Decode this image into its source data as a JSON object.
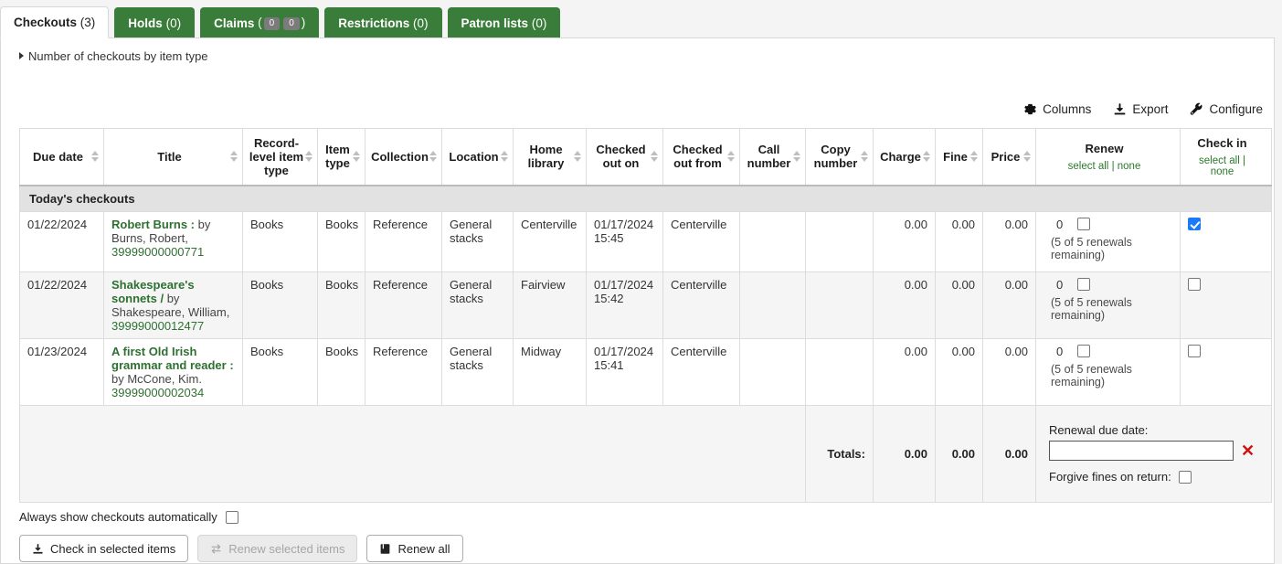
{
  "tabs": [
    {
      "label": "Checkouts",
      "count": "(3)",
      "active": true
    },
    {
      "label": "Holds",
      "count": "(0)",
      "active": false
    },
    {
      "label": "Claims",
      "count": "",
      "badges": [
        "0",
        "0"
      ],
      "active": false
    },
    {
      "label": "Restrictions",
      "count": "(0)",
      "active": false
    },
    {
      "label": "Patron lists",
      "count": "(0)",
      "active": false
    }
  ],
  "item_type_toggle": "Number of checkouts by item type",
  "toolbar": {
    "columns_label": "Columns",
    "export_label": "Export",
    "configure_label": "Configure"
  },
  "table": {
    "headers": [
      "Due date",
      "Title",
      "Record-level item type",
      "Item type",
      "Collection",
      "Location",
      "Home library",
      "Checked out on",
      "Checked out from",
      "Call number",
      "Copy number",
      "Charge",
      "Fine",
      "Price"
    ],
    "renew_header": "Renew",
    "checkin_header": "Check in",
    "select_all_label": "select all",
    "select_none_label": "none",
    "group_label": "Today's checkouts",
    "rows": [
      {
        "due_date": "01/22/2024",
        "title": "Robert Burns :",
        "byline": " by Burns, Robert,",
        "barcode": "39999000000771",
        "record_item_type": "Books",
        "item_type": "Books",
        "collection": "Reference",
        "location": "General stacks",
        "home_library": "Centerville",
        "checked_out_on": "01/17/2024 15:45",
        "checked_out_from": "Centerville",
        "call_number": "",
        "copy_number": "",
        "charge": "0.00",
        "fine": "0.00",
        "price": "0.00",
        "renew_count": "0",
        "renew_note": "(5 of 5 renewals remaining)",
        "renew_checked": false,
        "checkin_checked": true
      },
      {
        "due_date": "01/22/2024",
        "title": "Shakespeare's sonnets /",
        "byline": " by Shakespeare, William,",
        "barcode": "39999000012477",
        "record_item_type": "Books",
        "item_type": "Books",
        "collection": "Reference",
        "location": "General stacks",
        "home_library": "Fairview",
        "checked_out_on": "01/17/2024 15:42",
        "checked_out_from": "Centerville",
        "call_number": "",
        "copy_number": "",
        "charge": "0.00",
        "fine": "0.00",
        "price": "0.00",
        "renew_count": "0",
        "renew_note": "(5 of 5 renewals remaining)",
        "renew_checked": false,
        "checkin_checked": false
      },
      {
        "due_date": "01/23/2024",
        "title": "A first Old Irish grammar and reader :",
        "byline": " by McCone, Kim.",
        "barcode": "39999000002034",
        "record_item_type": "Books",
        "item_type": "Books",
        "collection": "Reference",
        "location": "General stacks",
        "home_library": "Midway",
        "checked_out_on": "01/17/2024 15:41",
        "checked_out_from": "Centerville",
        "call_number": "",
        "copy_number": "",
        "charge": "0.00",
        "fine": "0.00",
        "price": "0.00",
        "renew_count": "0",
        "renew_note": "(5 of 5 renewals remaining)",
        "renew_checked": false,
        "checkin_checked": false
      }
    ],
    "totals": {
      "label": "Totals:",
      "charge": "0.00",
      "fine": "0.00",
      "price": "0.00"
    },
    "renewal_due_date_label": "Renewal due date:",
    "renewal_due_date_value": "",
    "renewal_clear_icon": "✕",
    "forgive_label": "Forgive fines on return:"
  },
  "footer": {
    "always_show_label": "Always show checkouts automatically",
    "checkin_selected_btn": "Check in selected items",
    "renew_selected_btn": "Renew selected items",
    "renew_all_btn": "Renew all"
  },
  "colors": {
    "tab_green": "#3a7d3a",
    "link_green": "#2e7031",
    "checkbox_blue": "#1a7af8",
    "clear_red": "#cc1111"
  }
}
